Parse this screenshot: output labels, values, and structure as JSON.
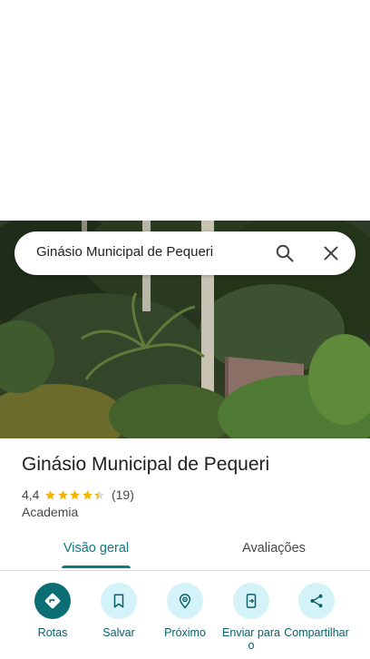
{
  "search": {
    "query": "Ginásio Municipal de Pequeri"
  },
  "place": {
    "title": "Ginásio Municipal de Pequeri",
    "rating": "4,4",
    "rating_stars": 4.4,
    "review_count": "(19)",
    "category": "Academia"
  },
  "tabs": [
    {
      "label": "Visão geral",
      "active": true
    },
    {
      "label": "Avaliações",
      "active": false
    }
  ],
  "actions": [
    {
      "label": "Rotas",
      "icon": "directions-icon"
    },
    {
      "label": "Salvar",
      "icon": "bookmark-icon"
    },
    {
      "label": "Próximo",
      "icon": "nearby-icon"
    },
    {
      "label": "Enviar para o",
      "icon": "send-to-phone-icon"
    },
    {
      "label": "Compartilhar",
      "icon": "share-icon"
    }
  ],
  "colors": {
    "accent": "#0b7a83",
    "action_bg": "#d4f3f8",
    "star": "#f4b400"
  }
}
